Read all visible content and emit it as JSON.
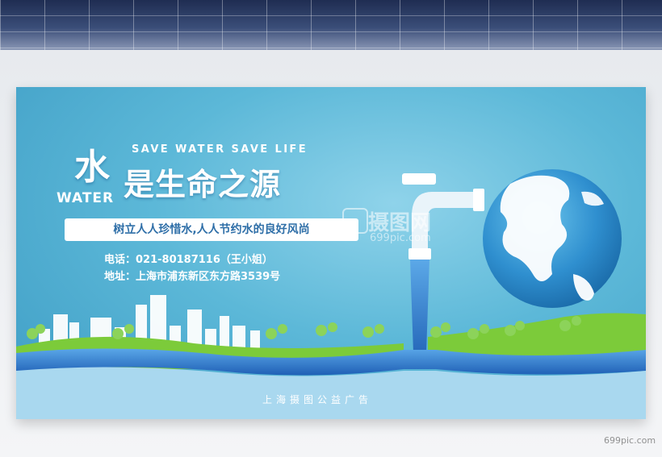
{
  "poster": {
    "subtitle_en": "SAVE WATER SAVE LIFE",
    "big_char": "水",
    "water_en": "WATER",
    "title": "是生命之源",
    "slogan": "树立人人珍惜水,人人节约水的良好风尚",
    "phone_line": "电话：021-80187116（王小姐）",
    "address_line": "地址：上海市浦东新区东方路3539号",
    "footer": "上海摄图公益广告"
  },
  "watermark": {
    "center_cn": "摄图网",
    "center_en": "699pic.com",
    "corner": "699pic.com"
  },
  "colors": {
    "sky": "#5cb8d8",
    "grass": "#7ccb3a",
    "river": "#2f6fc6",
    "ground": "#a9d8ef",
    "slogan_text": "#2f6fa8"
  }
}
